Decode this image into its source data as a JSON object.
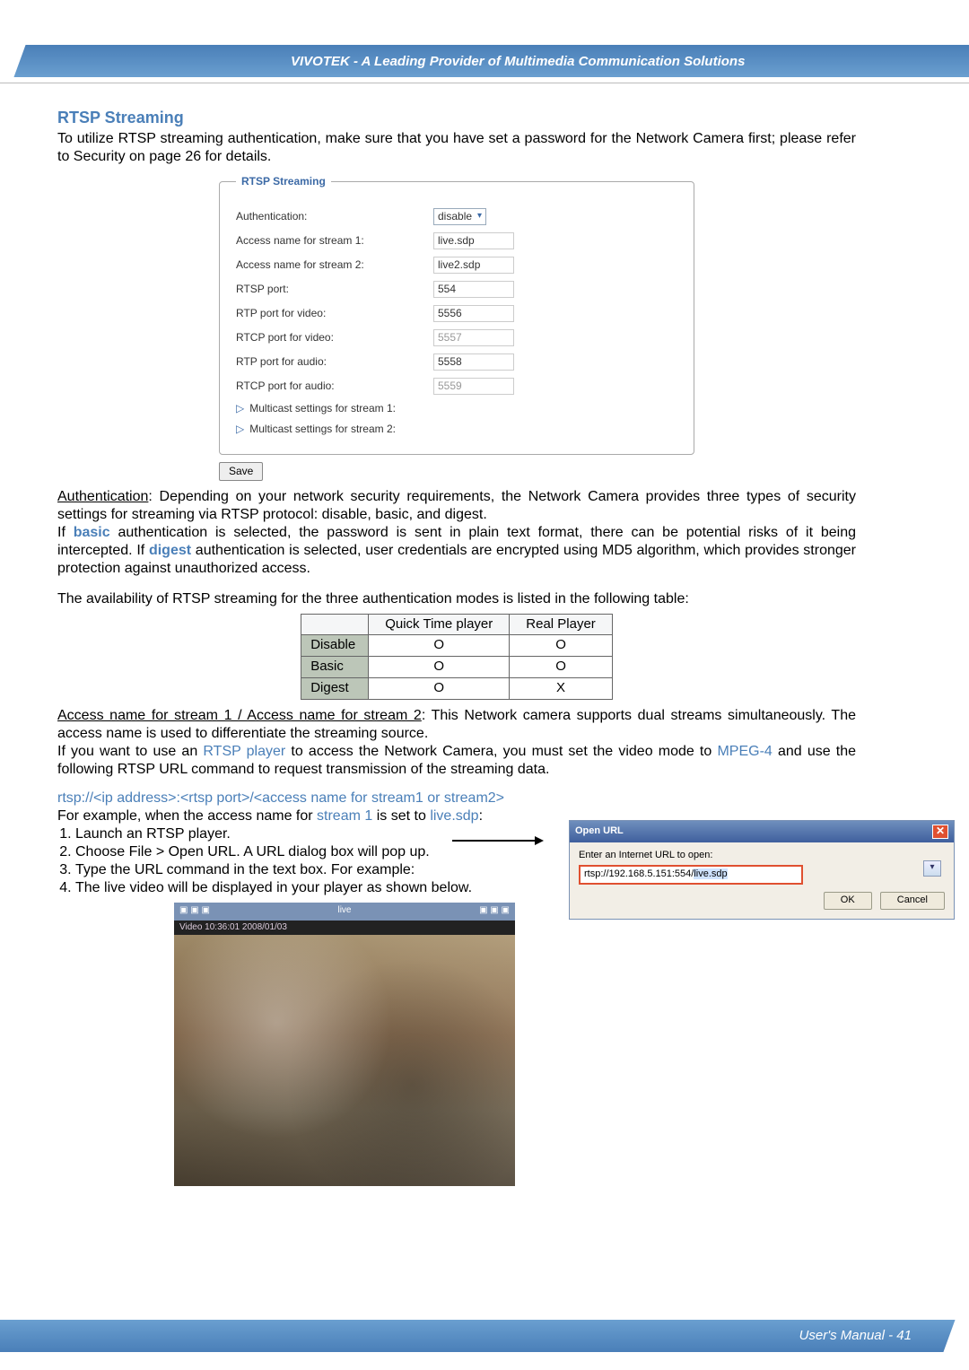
{
  "header": {
    "title": "VIVOTEK - A Leading Provider of Multimedia Communication Solutions"
  },
  "section": {
    "title": "RTSP Streaming"
  },
  "intro": "To utilize RTSP streaming authentication, make sure that you have set a password for the Network Camera first; please refer to Security on page 26 for details.",
  "fieldset": {
    "legend": "RTSP Streaming",
    "rows": {
      "auth": {
        "label": "Authentication:",
        "value": "disable"
      },
      "access1": {
        "label": "Access name for stream 1:",
        "value": "live.sdp"
      },
      "access2": {
        "label": "Access name for stream 2:",
        "value": "live2.sdp"
      },
      "rtsp_port": {
        "label": "RTSP port:",
        "value": "554"
      },
      "rtp_video": {
        "label": "RTP port for video:",
        "value": "5556"
      },
      "rtcp_video": {
        "label": "RTCP port for video:",
        "value": "5557"
      },
      "rtp_audio": {
        "label": "RTP port for audio:",
        "value": "5558"
      },
      "rtcp_audio": {
        "label": "RTCP port for audio:",
        "value": "5559"
      },
      "multicast1": "Multicast settings for stream 1:",
      "multicast2": "Multicast settings for stream 2:"
    },
    "save": "Save"
  },
  "paras": {
    "auth_label": "Authentication",
    "auth_rest": ": Depending on your network security requirements, the Network Camera provides three types of security settings for streaming via RTSP protocol: disable, basic, and digest.",
    "if_pre": "If ",
    "basic": "basic",
    "basic_rest": " authentication is selected, the password is sent in plain text format, there can be potential risks of it being intercepted. If ",
    "digest": "digest",
    "digest_rest": " authentication is selected, user credentials are encrypted using MD5 algorithm, which provides stronger protection against unauthorized access.",
    "avail": "The availability of RTSP streaming for the three authentication modes is listed in the following table:",
    "access_label": "Access name for stream 1 / Access name for stream 2",
    "access_rest": ": This Network camera supports dual streams simultaneously. The access name is used to differentiate the streaming source.",
    "access2_pre": "If you want to use an ",
    "rtsp_player": "RTSP player",
    "access2_mid": " to access the Network Camera, you must set the video mode to ",
    "mpeg4": "MPEG-4",
    "access2_end": " and use the following RTSP URL command to request transmission of the streaming data.",
    "url_template": "rtsp://<ip address>:<rtsp port>/<access name for stream1 or stream2>",
    "example_pre": "For example, when the access name for ",
    "stream1": "stream 1",
    "example_mid": " is set to ",
    "live_sdp": "live.sdp",
    "example_end": ":"
  },
  "steps": [
    "Launch an RTSP player.",
    "Choose File > Open URL. A URL dialog box will pop up.",
    "Type the URL command in the text box. For example:",
    "The live video will be displayed in your player as shown below."
  ],
  "auth_table": {
    "headers": [
      "",
      "Quick Time player",
      "Real Player"
    ],
    "rows": [
      [
        "Disable",
        "O",
        "O"
      ],
      [
        "Basic",
        "O",
        "O"
      ],
      [
        "Digest",
        "O",
        "X"
      ]
    ]
  },
  "dialog": {
    "title": "Open URL",
    "label": "Enter an Internet URL to open:",
    "url_prefix": "rtsp://192.168.5.151:554/",
    "url_hl": "live.sdp",
    "ok": "OK",
    "cancel": "Cancel"
  },
  "player_shot": {
    "titlebar": "live",
    "timestamp": "Video 10:36:01 2008/01/03"
  },
  "footer": {
    "text": "User's Manual - 41"
  }
}
